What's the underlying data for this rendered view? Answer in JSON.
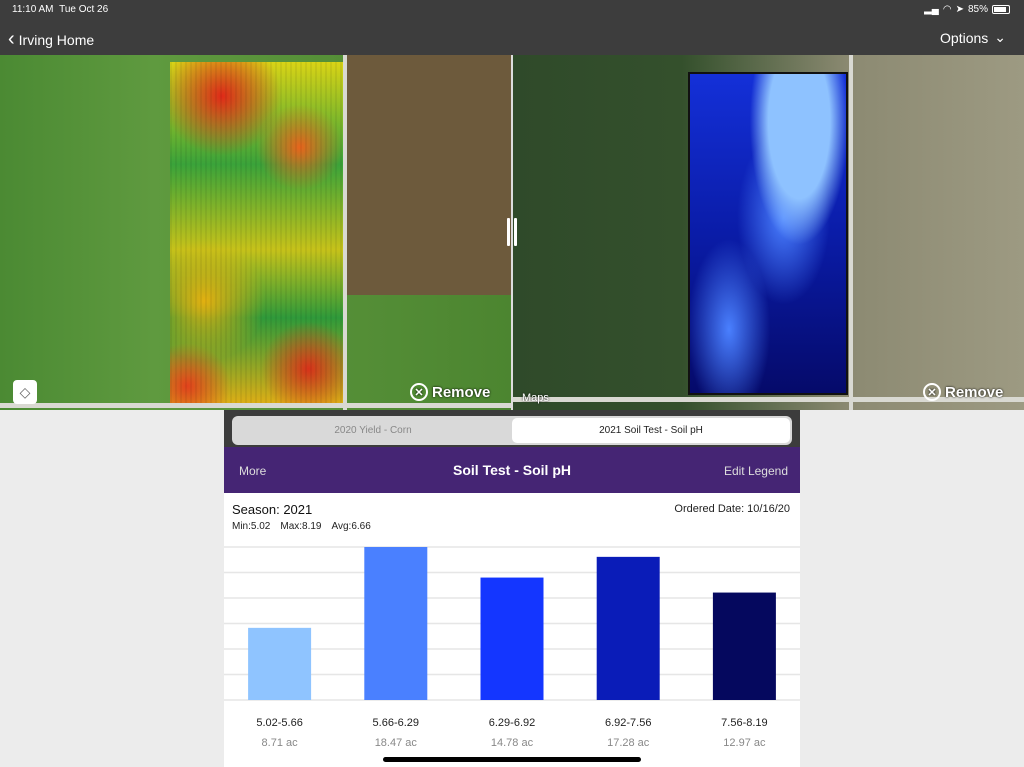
{
  "status_bar": {
    "time": "11:10 AM",
    "date": "Tue Oct 26",
    "battery": "85%",
    "battery_level": 0.85
  },
  "nav": {
    "back_label": "Irving Home",
    "options_label": "Options"
  },
  "maps": {
    "left_remove": "Remove",
    "right_remove": "Remove",
    "attribution": "Maps"
  },
  "segments": [
    {
      "label": "2020 Yield - Corn",
      "selected": false
    },
    {
      "label": "2021 Soil Test - Soil pH",
      "selected": true
    }
  ],
  "header": {
    "more": "More",
    "title": "Soil Test - Soil pH",
    "edit_legend": "Edit Legend"
  },
  "info": {
    "season": "Season: 2021",
    "ordered": "Ordered Date: 10/16/20",
    "min": "Min:5.02",
    "max": "Max:8.19",
    "avg": "Avg:6.66"
  },
  "chart_data": {
    "type": "bar",
    "categories": [
      "5.02-5.66",
      "5.66-6.29",
      "6.29-6.92",
      "6.92-7.56",
      "7.56-8.19"
    ],
    "values": [
      8.71,
      18.47,
      14.78,
      17.28,
      12.97
    ],
    "value_labels": [
      "8.71 ac",
      "18.47 ac",
      "14.78 ac",
      "17.28 ac",
      "12.97 ac"
    ],
    "colors": [
      "#8fc4ff",
      "#4a80ff",
      "#1436ff",
      "#0a1cb8",
      "#05085e"
    ],
    "grid": true
  }
}
